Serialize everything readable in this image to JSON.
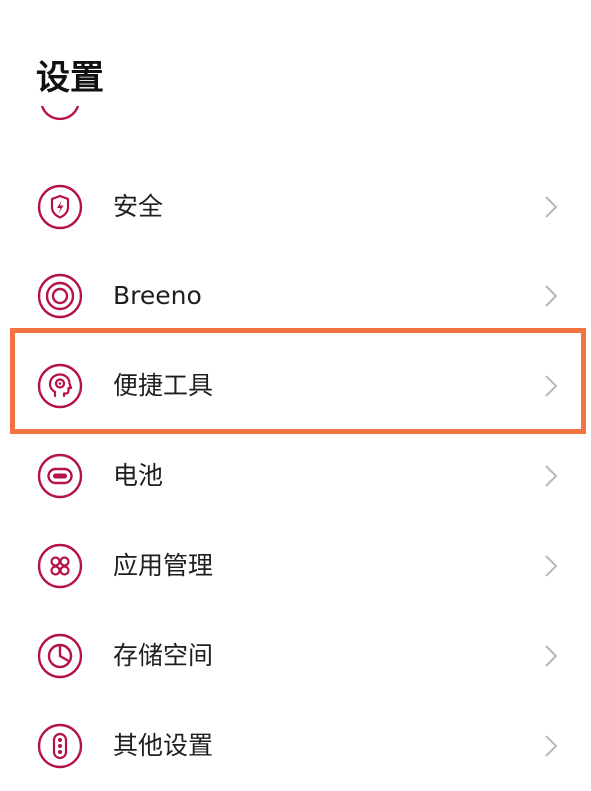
{
  "header": {
    "title": "设置"
  },
  "settings": {
    "items": [
      {
        "label": "安全",
        "icon": "shield-bolt-icon"
      },
      {
        "label": "Breeno",
        "icon": "breeno-icon"
      },
      {
        "label": "便捷工具",
        "icon": "head-gear-icon"
      },
      {
        "label": "电池",
        "icon": "battery-icon"
      },
      {
        "label": "应用管理",
        "icon": "app-grid-icon"
      },
      {
        "label": "存储空间",
        "icon": "storage-pie-icon"
      },
      {
        "label": "其他设置",
        "icon": "more-dots-icon"
      }
    ]
  },
  "colors": {
    "accent": "#b5124a",
    "highlight": "#f37342",
    "chevron": "#b8b8b8"
  },
  "highlighted_item": "便捷工具"
}
